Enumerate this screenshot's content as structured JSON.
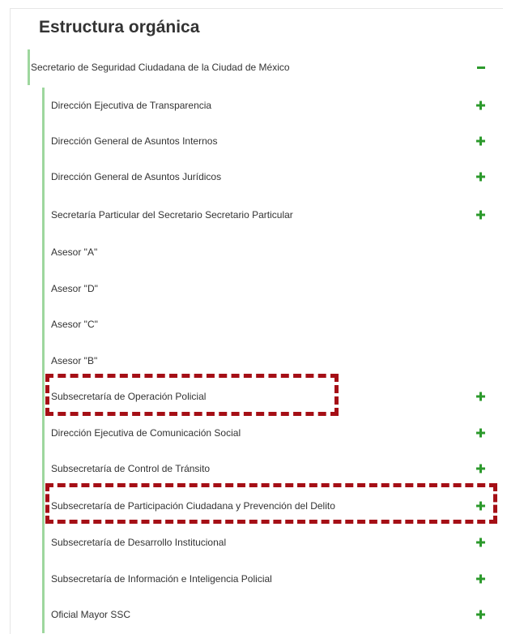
{
  "title": "Estructura orgánica",
  "root": {
    "label": "Secretario de Seguridad Ciudadana de la Ciudad de México",
    "expanded_icon": "minus-icon"
  },
  "children": [
    {
      "label": "Dirección Ejecutiva de Transparencia",
      "expandable": true
    },
    {
      "label": "Dirección General de Asuntos Internos",
      "expandable": true
    },
    {
      "label": "Dirección General de Asuntos Jurídicos",
      "expandable": true
    },
    {
      "label": "Secretaría Particular del Secretario Secretario Particular",
      "expandable": true
    },
    {
      "label": "Asesor \"A\"",
      "expandable": false
    },
    {
      "label": "Asesor \"D\"",
      "expandable": false
    },
    {
      "label": "Asesor \"C\"",
      "expandable": false
    },
    {
      "label": "Asesor \"B\"",
      "expandable": false
    },
    {
      "label": "Subsecretaría de Operación Policial",
      "expandable": true
    },
    {
      "label": "Dirección Ejecutiva de Comunicación Social",
      "expandable": true
    },
    {
      "label": "Subsecretaría de Control de Tránsito",
      "expandable": true
    },
    {
      "label": "Subsecretaría de Participación Ciudadana y Prevención del Delito",
      "expandable": true
    },
    {
      "label": "Subsecretaría de Desarrollo Institucional",
      "expandable": true
    },
    {
      "label": "Subsecretaría de Información e Inteligencia Policial",
      "expandable": true
    },
    {
      "label": "Oficial Mayor SSC",
      "expandable": true
    }
  ],
  "colors": {
    "accent_green": "#2c9a2c",
    "tree_line": "#9ed79e",
    "highlight_red": "#a50f16"
  }
}
